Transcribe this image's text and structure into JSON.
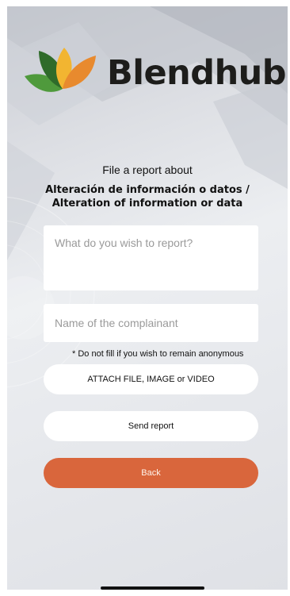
{
  "brand": {
    "name": "Blendhub",
    "colors": {
      "leaf_green": "#4f9a3c",
      "leaf_dark": "#2f6b2a",
      "leaf_orange": "#e88a2e",
      "leaf_yellow": "#f2b531"
    }
  },
  "report": {
    "heading": "File a report about",
    "topic": "Alteración de información o datos / Alteration of information or data",
    "description_placeholder": "What do you wish to report?",
    "complainant_placeholder": "Name of the complainant",
    "anonymous_note": "* Do not fill if you wish to remain anonymous"
  },
  "actions": {
    "attach_label": "ATTACH FILE, IMAGE or VIDEO",
    "send_label": "Send report",
    "back_label": "Back"
  },
  "colors": {
    "accent": "#d9663c",
    "button_bg": "#ffffff"
  }
}
